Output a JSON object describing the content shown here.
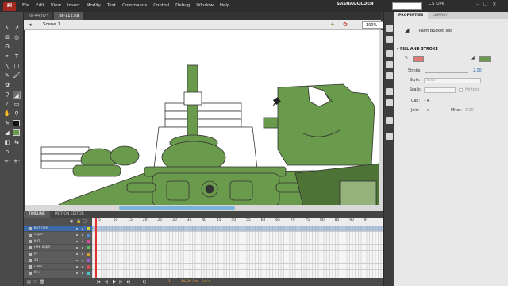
{
  "app": {
    "logo": "Fl"
  },
  "menu": [
    "File",
    "Edit",
    "View",
    "Insert",
    "Modify",
    "Text",
    "Commands",
    "Control",
    "Debug",
    "Window",
    "Help"
  ],
  "workspace": "SASHAGOLDEN",
  "cs_live": "CS Live",
  "window_controls": [
    "–",
    "❐",
    "✕"
  ],
  "doc_tabs": [
    "кв-44.flv*",
    "кв-112.fla"
  ],
  "edit_bar": {
    "scene": "Scene 1",
    "zoom": "100%"
  },
  "timeline": {
    "tabs": [
      "TIMELINE",
      "MOTION EDITOR"
    ],
    "frame_numbers": [
      "5",
      "10",
      "15",
      "20",
      "25",
      "30",
      "35",
      "40",
      "45",
      "50",
      "55",
      "60",
      "65",
      "70",
      "75",
      "80",
      "85",
      "90",
      "9"
    ],
    "layers": [
      {
        "name": "вот пем",
        "color": "#e1d02b",
        "active": true
      },
      {
        "name": "корп",
        "color": "#4f8bd6"
      },
      {
        "name": "кат",
        "color": "#d64f9c"
      },
      {
        "name": "ник корп",
        "color": "#56c45a"
      },
      {
        "name": "pt",
        "color": "#d4a030"
      },
      {
        "name": "зд",
        "color": "#9f5fd4"
      },
      {
        "name": "глаз",
        "color": "#d84b4b"
      },
      {
        "name": "бгн",
        "color": "#4fc4c4"
      }
    ],
    "footer": {
      "frame": "1",
      "fps": "24,00 fps",
      "time": "0,0 s"
    }
  },
  "properties": {
    "tabs": [
      "PROPERTIES",
      "LIBRARY"
    ],
    "tool_name": "Paint Bucket Tool",
    "section": "FILL AND STROKE",
    "stroke_label": "Stroke:",
    "stroke_value": "2,00",
    "style_label": "Style:",
    "style_value": "Solid",
    "scale_label": "Scale:",
    "hinting_label": "Hinting",
    "cap_label": "Cap:",
    "join_label": "Join:",
    "miter_label": "Miter:",
    "miter_value": "3,00",
    "fill_color": "#6a9b4c",
    "stroke_color": "#e37a7a"
  },
  "colors": {
    "tank_green": "#6a9b4c",
    "tank_dark": "#4e7336",
    "stage_bg": "#ffffff"
  }
}
